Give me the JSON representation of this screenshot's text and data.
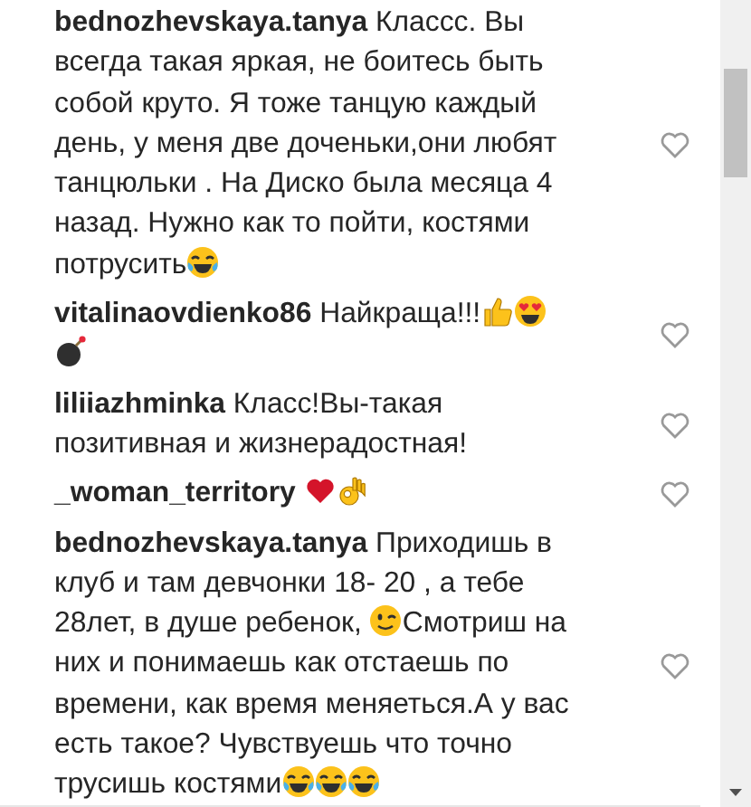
{
  "comments": [
    {
      "username": "bednozhevskaya.tanya",
      "parts": [
        {
          "kind": "text",
          "text": "Классс. Вы всегда такая яркая, не боитесь быть собой круто. Я тоже танцую каждый день, у меня две доченьки,они любят танцюльки . На Диско была месяца 4 назад. Нужно как то пойти, костями потрусить"
        },
        {
          "kind": "laugh"
        }
      ]
    },
    {
      "username": "vitalinaovdienko86",
      "parts": [
        {
          "kind": "text",
          "text": "Найкраща!!!"
        },
        {
          "kind": "thumb"
        },
        {
          "kind": "hearteyes"
        },
        {
          "kind": "bomb"
        }
      ]
    },
    {
      "username": "liliiazhminka",
      "parts": [
        {
          "kind": "text",
          "text": "Класс!Вы-такая позитивная и жизнерадостная!"
        }
      ]
    },
    {
      "username": "_woman_territory",
      "parts": [
        {
          "kind": "heart"
        },
        {
          "kind": "ok"
        }
      ]
    },
    {
      "username": "bednozhevskaya.tanya",
      "parts": [
        {
          "kind": "text",
          "text": "Приходишь в клуб и там девчонки 18- 20 , а тебе 28лет, в душе ребенок, "
        },
        {
          "kind": "wink"
        },
        {
          "kind": "text",
          "text": "Смотриш на них и понимаешь как отстаешь по времени, как время меняеться.А у вас есть такое? Чувствуешь что точно трусишь костями"
        },
        {
          "kind": "laugh"
        },
        {
          "kind": "laugh"
        },
        {
          "kind": "laugh"
        }
      ]
    }
  ]
}
